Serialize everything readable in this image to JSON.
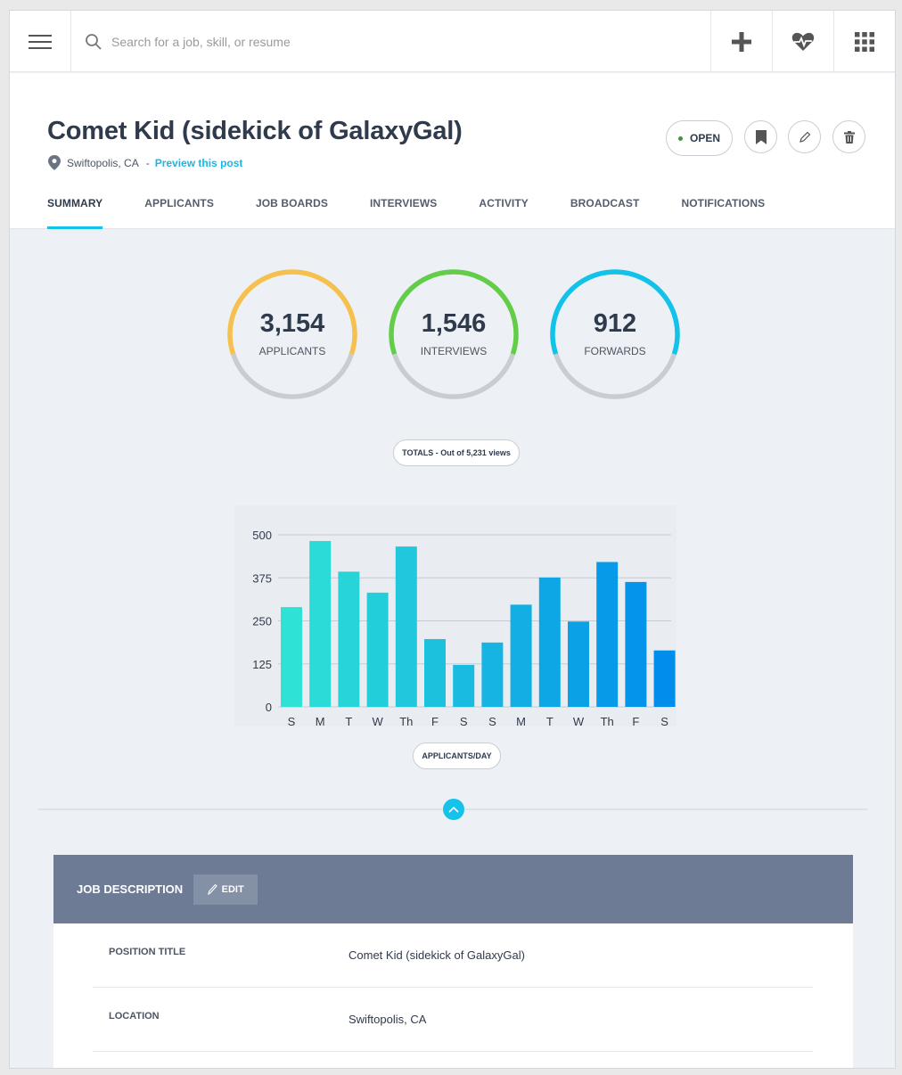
{
  "search": {
    "placeholder": "Search for a job, skill, or resume"
  },
  "toolbar": {
    "icons": [
      "menu-icon",
      "search-icon",
      "plus-icon",
      "heart-pulse-icon",
      "grid-icon"
    ]
  },
  "job": {
    "title": "Comet Kid (sidekick of GalaxyGal)",
    "location": "Swiftopolis, CA",
    "separator": "-",
    "preview_link": "Preview this post",
    "status": "OPEN"
  },
  "tabs": [
    {
      "label": "SUMMARY",
      "active": true
    },
    {
      "label": "APPLICANTS"
    },
    {
      "label": "JOB BOARDS"
    },
    {
      "label": "INTERVIEWS"
    },
    {
      "label": "ACTIVITY"
    },
    {
      "label": "BROADCAST"
    },
    {
      "label": "NOTIFICATIONS"
    }
  ],
  "stats": [
    {
      "value": "3,154",
      "label": "APPLICANTS",
      "color": "#f6c04f",
      "fraction": 0.603
    },
    {
      "value": "1,546",
      "label": "INTERVIEWS",
      "color": "#63cd4a",
      "fraction": 0.603
    },
    {
      "value": "912",
      "label": "FORWARDS",
      "color": "#12c2e9",
      "fraction": 0.603
    }
  ],
  "totals_pill": "TOTALS - Out of 5,231 views",
  "chart_pill": "APPLICANTS/DAY",
  "chart_data": {
    "type": "bar",
    "categories": [
      "S",
      "M",
      "T",
      "W",
      "Th",
      "F",
      "S",
      "S",
      "M",
      "T",
      "W",
      "Th",
      "F",
      "S"
    ],
    "values": [
      290,
      482,
      393,
      332,
      466,
      197,
      122,
      187,
      297,
      376,
      248,
      421,
      363,
      164
    ],
    "yticks": [
      "0",
      "125",
      "250",
      "375",
      "500"
    ],
    "ylim": [
      0,
      500
    ],
    "grid": true,
    "title": "",
    "xlabel": "",
    "ylabel": ""
  },
  "job_description": {
    "title": "JOB DESCRIPTION",
    "edit_label": "EDIT",
    "rows": [
      {
        "key": "POSITION TITLE",
        "value": "Comet Kid (sidekick of GalaxyGal)"
      },
      {
        "key": "LOCATION",
        "value": "Swiftopolis, CA"
      }
    ]
  },
  "colors": {
    "accent": "#15c3ea",
    "panel": "#6e7b94",
    "ring_track": "#c9ccd1"
  }
}
